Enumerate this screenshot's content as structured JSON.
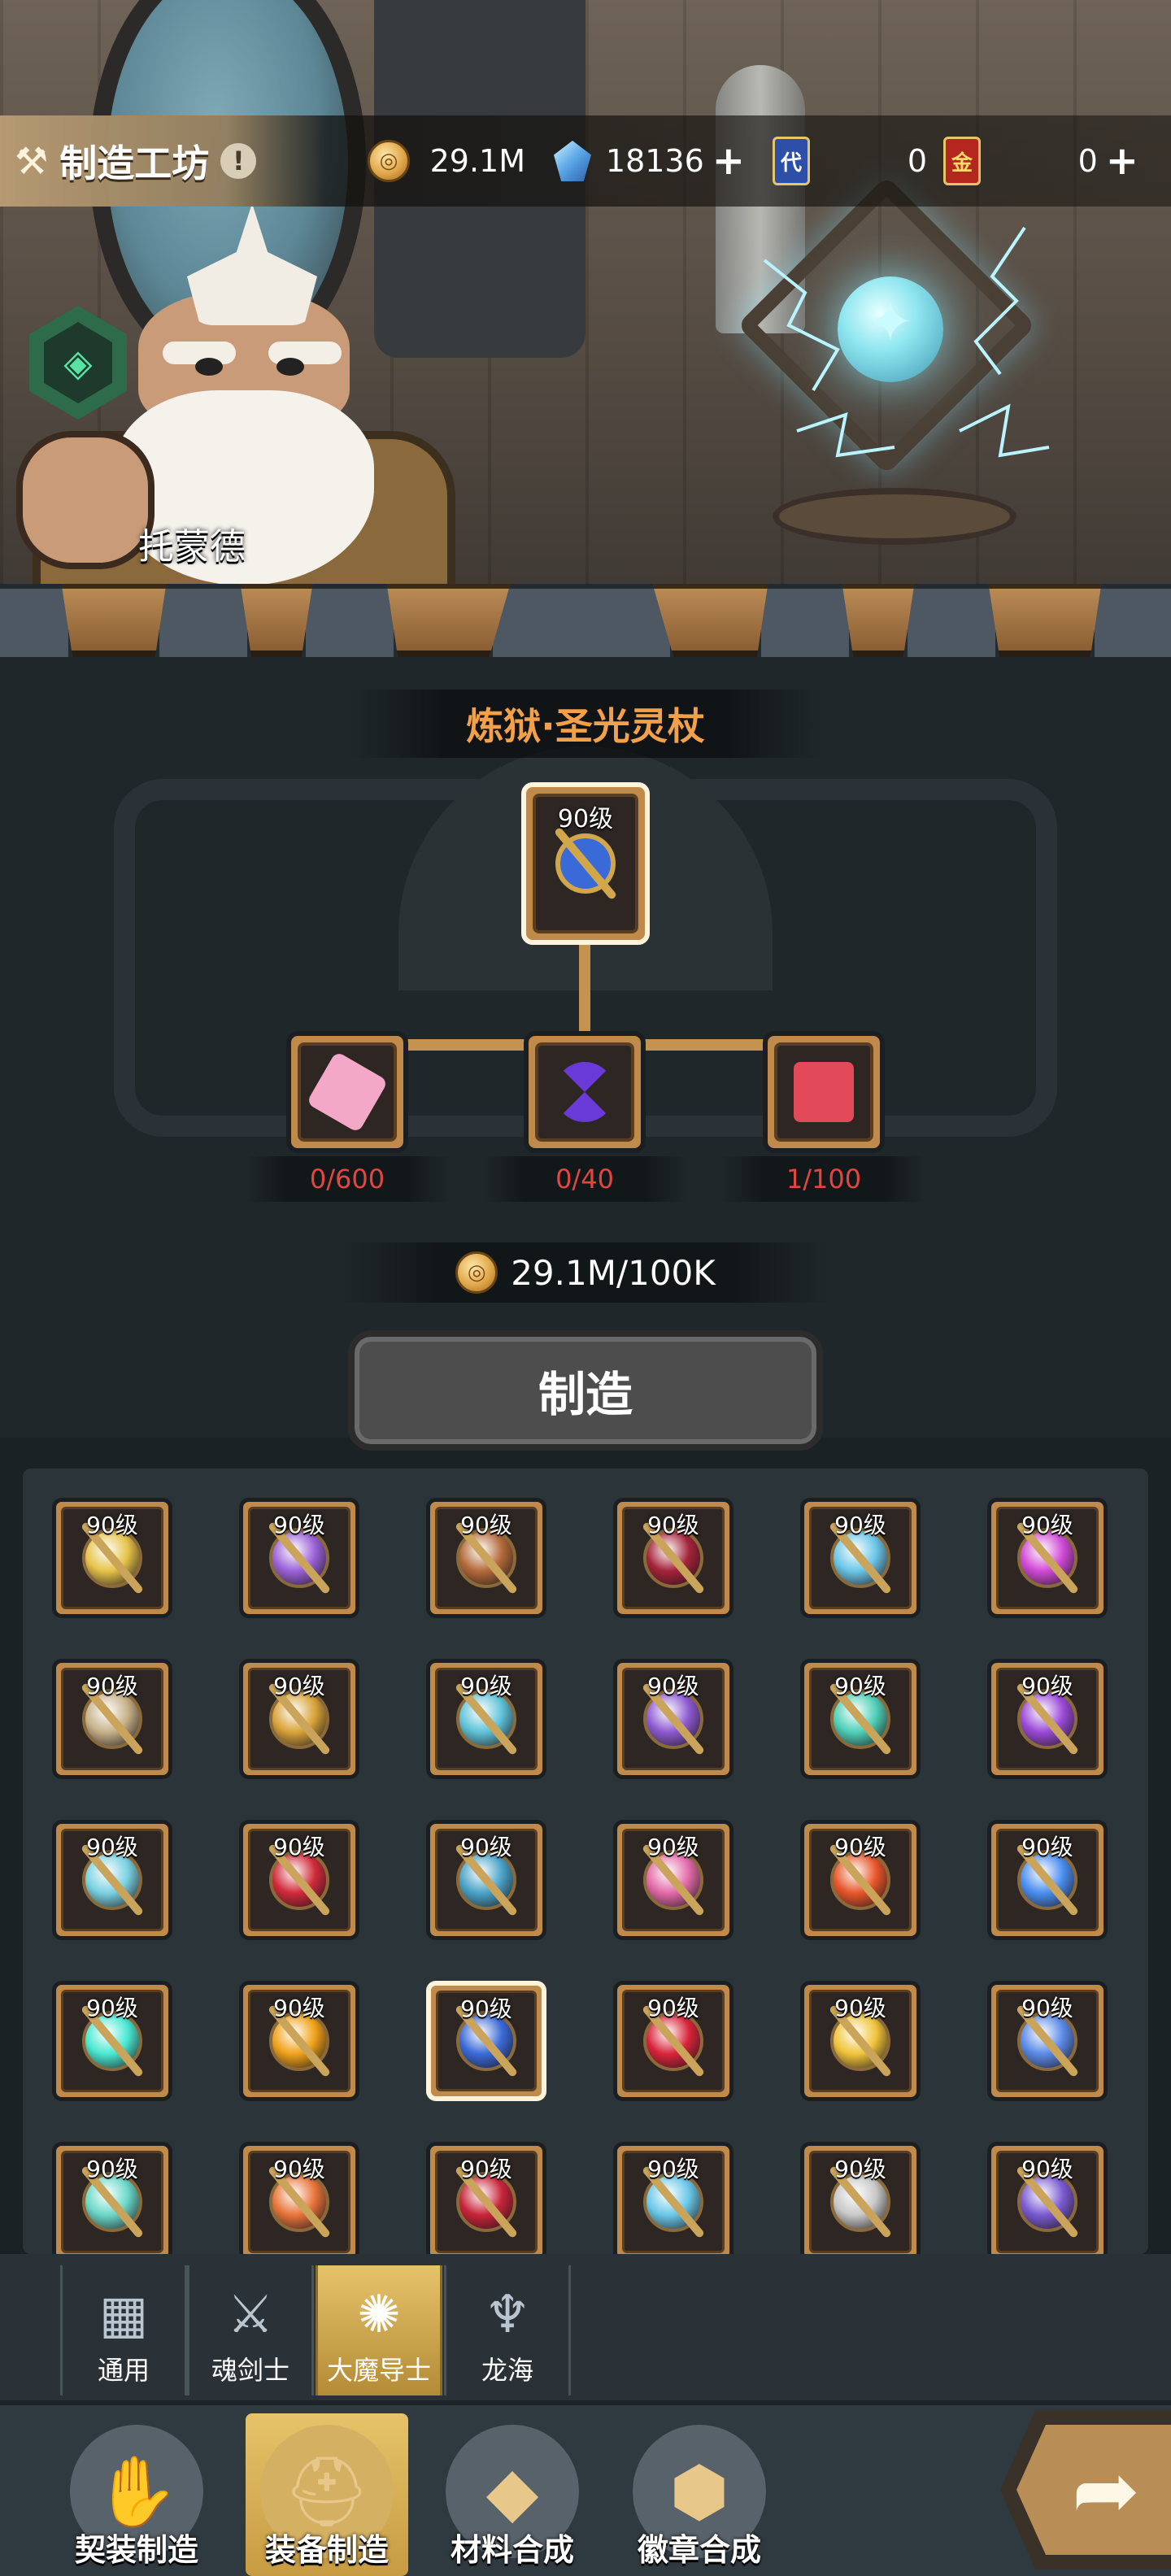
{
  "header": {
    "title": "制造工坊",
    "info_icon": "exclamation-icon",
    "currencies": [
      {
        "name": "gold-coin",
        "value": "29.1M",
        "has_plus": false
      },
      {
        "name": "crystal",
        "value": "18136",
        "has_plus": true
      },
      {
        "name": "blue-card",
        "glyph": "代",
        "value": "0",
        "has_plus": false
      },
      {
        "name": "red-card",
        "glyph": "金",
        "value": "0",
        "has_plus": true
      }
    ]
  },
  "npc": {
    "name": "托蒙德"
  },
  "recipe": {
    "title": "炼狱·圣光灵杖",
    "target_level": "90级",
    "materials": [
      {
        "icon": "crystal-scroll-icon",
        "count": "0/600"
      },
      {
        "icon": "hourglass-gem-icon",
        "count": "0/40"
      },
      {
        "icon": "gem-cluster-icon",
        "count": "1/100"
      }
    ],
    "cost": "29.1M/100K",
    "craft_label": "制造"
  },
  "items": [
    {
      "level": "90级",
      "icon": "duck-staff-icon",
      "color": "#e6c34a"
    },
    {
      "level": "90级",
      "icon": "astral-ring-icon",
      "color": "#9b62d9"
    },
    {
      "level": "90级",
      "icon": "shadow-staff-icon",
      "color": "#b46a3a"
    },
    {
      "level": "90级",
      "icon": "ruby-compass-icon",
      "color": "#a4233a"
    },
    {
      "level": "90级",
      "icon": "ice-axe-staff-icon",
      "color": "#6bc6e8"
    },
    {
      "level": "90级",
      "icon": "void-eye-icon",
      "color": "#d04ad6"
    },
    {
      "level": "90级",
      "icon": "wing-cross-icon",
      "color": "#c7b28a"
    },
    {
      "level": "90级",
      "icon": "gold-ring-icon",
      "color": "#d9a43a"
    },
    {
      "level": "90级",
      "icon": "feather-staff-icon",
      "color": "#5fc3d9"
    },
    {
      "level": "90级",
      "icon": "amethyst-wreath-icon",
      "color": "#8d5ad2"
    },
    {
      "level": "90级",
      "icon": "jade-spear-icon",
      "color": "#4fd0b8"
    },
    {
      "level": "90级",
      "icon": "purple-orb-icon",
      "color": "#9a4ad8"
    },
    {
      "level": "90级",
      "icon": "gauntlet-staff-icon",
      "color": "#7ad1e2"
    },
    {
      "level": "90级",
      "icon": "ruby-shield-icon",
      "color": "#d12a3a"
    },
    {
      "level": "90级",
      "icon": "spiral-staff-icon",
      "color": "#4aa3c9"
    },
    {
      "level": "90级",
      "icon": "demon-heart-icon",
      "color": "#e26aa8"
    },
    {
      "level": "90级",
      "icon": "fire-orb-staff-icon",
      "color": "#e8562a"
    },
    {
      "level": "90级",
      "icon": "frost-crown-icon",
      "color": "#4a8ef0"
    },
    {
      "level": "90级",
      "icon": "glowing-cube-staff-icon",
      "color": "#4ae8d2"
    },
    {
      "level": "90级",
      "icon": "sun-compass-icon",
      "color": "#f0a21a"
    },
    {
      "level": "90级",
      "icon": "holy-light-staff-icon",
      "color": "#3a6ad8",
      "selected": true
    },
    {
      "level": "90级",
      "icon": "demon-mask-icon",
      "color": "#d8243a"
    },
    {
      "level": "90级",
      "icon": "amber-cube-staff-icon",
      "color": "#f0c43a"
    },
    {
      "level": "90级",
      "icon": "angel-eye-icon",
      "color": "#5a8ae8"
    },
    {
      "level": "90级",
      "icon": "cyan-angel-staff-icon",
      "color": "#6ad8c8"
    },
    {
      "level": "90级",
      "icon": "flame-horn-icon",
      "color": "#e8743a"
    },
    {
      "level": "90级",
      "icon": "blood-rune-icon",
      "color": "#c8243a"
    },
    {
      "level": "90级",
      "icon": "aqua-ring-icon",
      "color": "#6ac8e8"
    },
    {
      "level": "90级",
      "icon": "bone-staff-icon",
      "color": "#c8c8c8"
    },
    {
      "level": "90级",
      "icon": "raven-staff-icon",
      "color": "#7a5ad2"
    }
  ],
  "class_tabs": [
    {
      "label": "通用",
      "icon": "blocks-icon",
      "active": false
    },
    {
      "label": "魂剑士",
      "icon": "sword-icon",
      "active": false
    },
    {
      "label": "大魔导士",
      "icon": "magic-burst-icon",
      "active": true
    },
    {
      "label": "龙海",
      "icon": "trident-icon",
      "active": false
    }
  ],
  "bottom_nav": [
    {
      "label": "契装制造",
      "icon": "claw-icon",
      "active": false
    },
    {
      "label": "装备制造",
      "icon": "helmet-icon",
      "active": true
    },
    {
      "label": "材料合成",
      "icon": "crystal-icon",
      "active": false
    },
    {
      "label": "徽章合成",
      "icon": "hex-badge-icon",
      "active": false
    }
  ],
  "back_icon": "return-arrow-icon"
}
